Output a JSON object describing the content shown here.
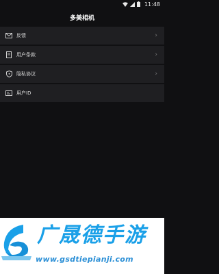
{
  "status": {
    "time": "11:48"
  },
  "header": {
    "title": "多美相机"
  },
  "menu": [
    {
      "icon": "mail-icon",
      "label": "反馈"
    },
    {
      "icon": "document-icon",
      "label": "用户条款"
    },
    {
      "icon": "shield-icon",
      "label": "隐私协议"
    },
    {
      "icon": "id-card-icon",
      "label": "用户ID"
    }
  ],
  "watermark": {
    "title": "广晟德手游",
    "url": "www.gsdtiepianji.com"
  },
  "colors": {
    "background": "#101012",
    "row": "#1f1f22",
    "brand": "#1aa0e8"
  }
}
